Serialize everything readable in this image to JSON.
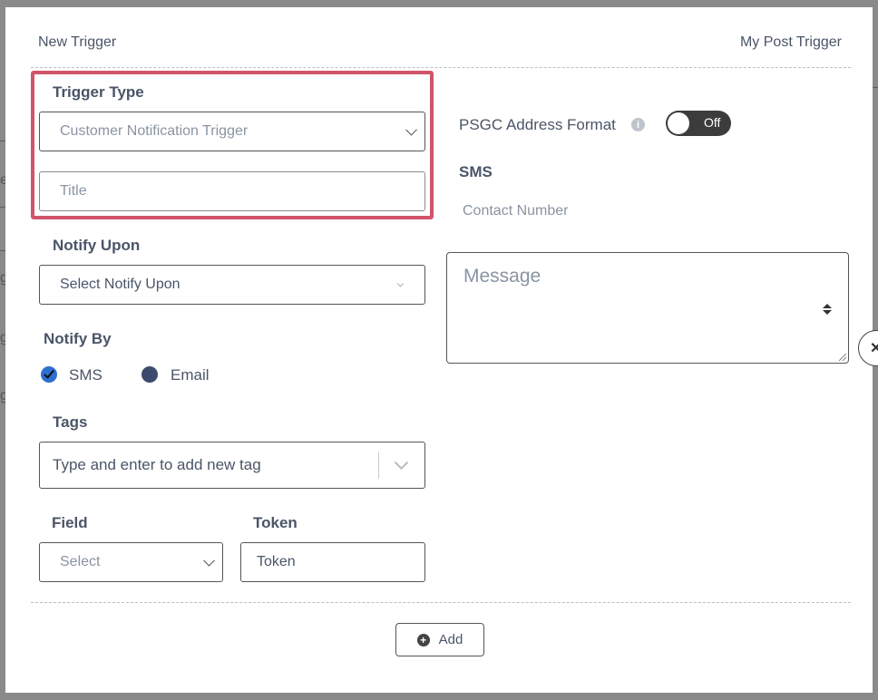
{
  "header": {
    "left_title": "New Trigger",
    "right_title": "My Post Trigger"
  },
  "trigger_type": {
    "label": "Trigger Type",
    "selected": "Customer Notification Trigger",
    "title_placeholder": "Title"
  },
  "notify_upon": {
    "label": "Notify Upon",
    "selected": "Select Notify Upon"
  },
  "notify_by": {
    "label": "Notify By",
    "options": [
      {
        "label": "SMS",
        "checked": true
      },
      {
        "label": "Email",
        "checked": false
      }
    ]
  },
  "tags": {
    "label": "Tags",
    "placeholder": "Type and enter to add new tag"
  },
  "field": {
    "label": "Field",
    "selected": "Select"
  },
  "token": {
    "label": "Token",
    "value": "Token"
  },
  "psgc": {
    "label": "PSGC Address Format",
    "info_icon": "info-icon",
    "toggle_text": "Off",
    "toggle_on": false
  },
  "sms": {
    "label": "SMS",
    "contact_placeholder": "Contact Number",
    "message_placeholder": "Message"
  },
  "footer": {
    "add_label": "Add"
  },
  "background": {
    "close_glyph": "✕",
    "edge_chars": [
      "e",
      "g",
      "g",
      "g"
    ]
  },
  "colors": {
    "highlight": "#d05568",
    "radio_checked": "#2f6fd1",
    "radio_unchecked": "#3c4b6b",
    "toggle_bg": "#3c3c3c"
  }
}
